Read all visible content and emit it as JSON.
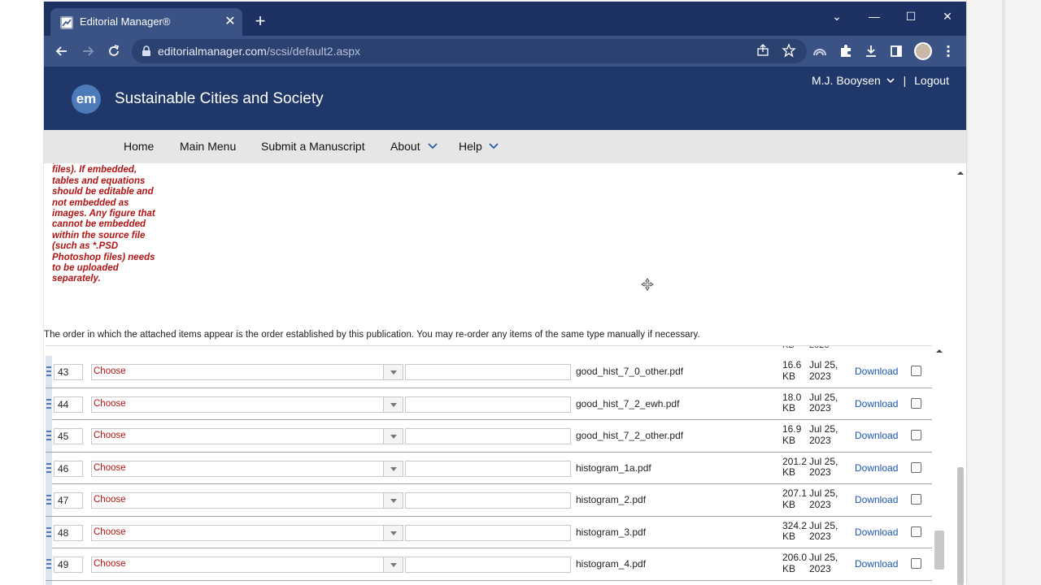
{
  "browser": {
    "tab_title": "Editorial Manager®",
    "tab_close": "✕",
    "new_tab": "+",
    "url_host": "editorialmanager.com",
    "url_path": "/scsi/default2.aspx",
    "controls": {
      "minimize": "—",
      "maximize": "☐",
      "close": "✕",
      "tab_list": "⌄"
    }
  },
  "site": {
    "logo_text": "em",
    "journal_title": "Sustainable Cities and Society",
    "user_name": "M.J. Booysen",
    "separator": "|",
    "logout": "Logout"
  },
  "nav": {
    "home": "Home",
    "main_menu": "Main Menu",
    "submit": "Submit a Manuscript",
    "about": "About",
    "help": "Help"
  },
  "note": {
    "text": "(TIFF, EPS or MS Office\nfiles). If embedded,\ntables and equations\nshould be editable and\nnot embedded as\nimages. Any figure that\ncannot be embedded\nwithin the source file\n(such as *.PSD\nPhotoshop files) needs\nto be uploaded\nseparately."
  },
  "order_message": "The order in which the attached items appear is the order established by this publication. You may re-order any items of the same type manually if necessary.",
  "clipped_row": {
    "size": "KB",
    "date": "2023"
  },
  "files": [
    {
      "order": "43",
      "type": "Choose",
      "filename": "good_hist_7_0_other.pdf",
      "size": "16.6 KB",
      "date": "Jul 25, 2023",
      "action": "Download"
    },
    {
      "order": "44",
      "type": "Choose",
      "filename": "good_hist_7_2_ewh.pdf",
      "size": "18.0 KB",
      "date": "Jul 25, 2023",
      "action": "Download"
    },
    {
      "order": "45",
      "type": "Choose",
      "filename": "good_hist_7_2_other.pdf",
      "size": "16.9 KB",
      "date": "Jul 25, 2023",
      "action": "Download"
    },
    {
      "order": "46",
      "type": "Choose",
      "filename": "histogram_1a.pdf",
      "size": "201.2 KB",
      "date": "Jul 25, 2023",
      "action": "Download"
    },
    {
      "order": "47",
      "type": "Choose",
      "filename": "histogram_2.pdf",
      "size": "207.1 KB",
      "date": "Jul 25, 2023",
      "action": "Download"
    },
    {
      "order": "48",
      "type": "Choose",
      "filename": "histogram_3.pdf",
      "size": "324.2 KB",
      "date": "Jul 25, 2023",
      "action": "Download"
    },
    {
      "order": "49",
      "type": "Choose",
      "filename": "histogram_4.pdf",
      "size": "206.0 KB",
      "date": "Jul 25, 2023",
      "action": "Download"
    }
  ],
  "colors": {
    "header": "#1f3769",
    "chrome": "#1e3163",
    "alert": "#b31414",
    "link": "#1a56b0"
  }
}
